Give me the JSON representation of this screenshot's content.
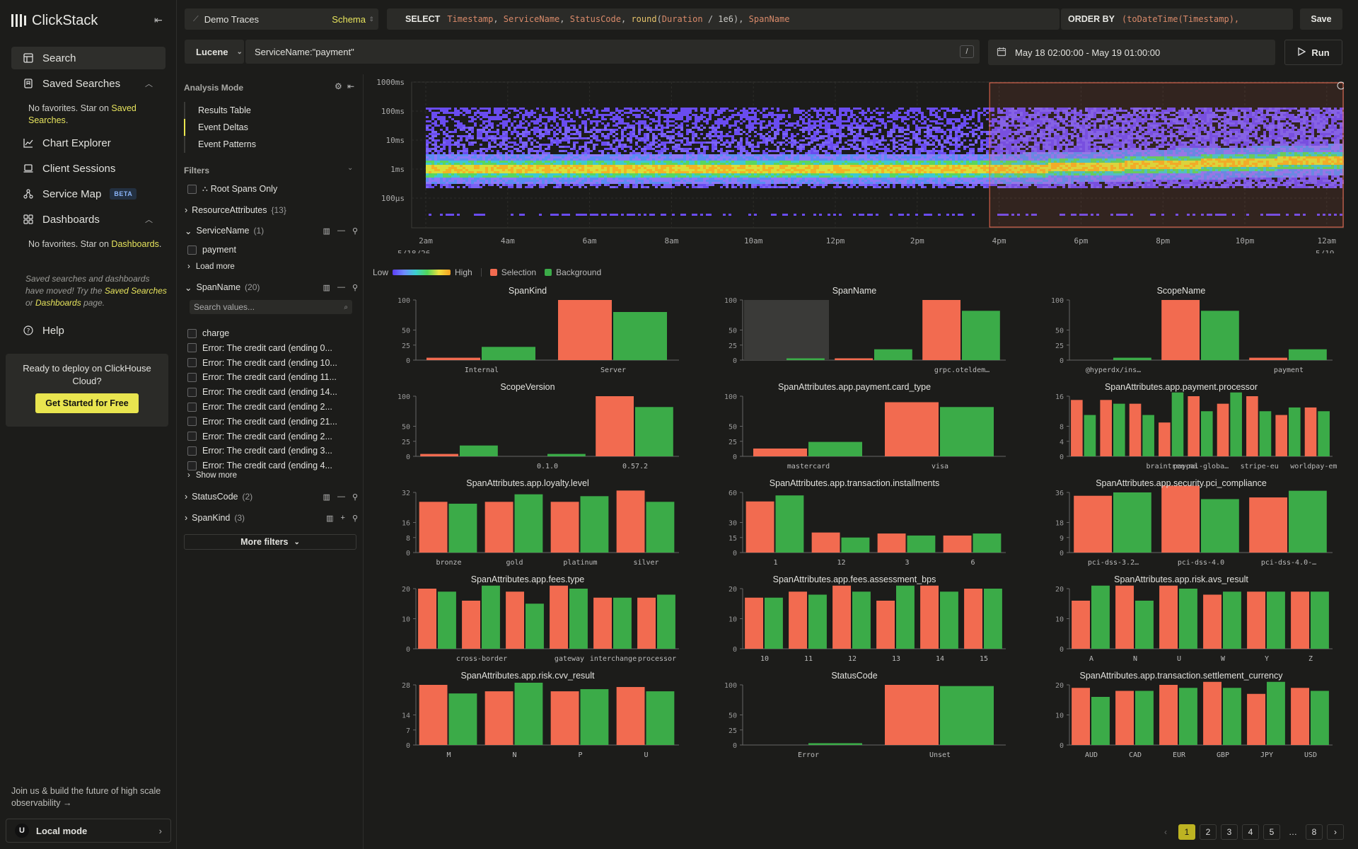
{
  "app": {
    "name": "ClickStack"
  },
  "nav": {
    "items": [
      {
        "label": "Search",
        "icon": "table-icon"
      },
      {
        "label": "Saved Searches",
        "icon": "bookmark-icon"
      },
      {
        "label": "Chart Explorer",
        "icon": "line-chart-icon"
      },
      {
        "label": "Client Sessions",
        "icon": "laptop-icon"
      },
      {
        "label": "Service Map",
        "icon": "graph-icon",
        "badge": "BETA"
      },
      {
        "label": "Dashboards",
        "icon": "grid-icon"
      },
      {
        "label": "Help",
        "icon": "help-icon"
      }
    ],
    "saved_note": {
      "pre": "No favorites. Star on ",
      "link": "Saved Searches",
      "post": "."
    },
    "dash_note": {
      "pre": "No favorites. Star on ",
      "link": "Dashboards",
      "post": "."
    },
    "moved": {
      "a": "Saved searches and dashboards have moved! Try the ",
      "link1": "Saved Searches",
      "b": " or ",
      "link2": "Dashboards",
      "c": " page."
    },
    "cloud": {
      "text": "Ready to deploy on ClickHouse Cloud?",
      "button": "Get Started for Free"
    },
    "join": "Join us & build the future of high scale observability →",
    "user": {
      "initial": "U",
      "mode": "Local mode"
    }
  },
  "topbar": {
    "source": "Demo Traces",
    "schema": "Schema",
    "select_kw": "SELECT",
    "select_value": "Timestamp, ServiceName, StatusCode, round(Duration / 1e6), SpanName",
    "orderby_kw": "ORDER BY",
    "orderby_value": "(toDateTime(Timestamp),",
    "save": "Save",
    "lang": "Lucene",
    "query": "ServiceName:\"payment\"",
    "slash": "/",
    "daterange": "May 18 02:00:00 - May 19 01:00:00",
    "run": "Run"
  },
  "filters": {
    "analysis_mode": "Analysis Mode",
    "modes": [
      "Results Table",
      "Event Deltas",
      "Event Patterns"
    ],
    "filters_label": "Filters",
    "root_spans": "Root Spans Only",
    "resource": {
      "label": "ResourceAttributes",
      "count": "{13}"
    },
    "service": {
      "label": "ServiceName",
      "count": "(1)",
      "values": [
        "payment"
      ],
      "load_more": "Load more"
    },
    "span": {
      "label": "SpanName",
      "count": "(20)",
      "search_placeholder": "Search values...",
      "values": [
        "charge",
        "Error: The credit card (ending 0...",
        "Error: The credit card (ending 10...",
        "Error: The credit card (ending 11...",
        "Error: The credit card (ending 14...",
        "Error: The credit card (ending 2...",
        "Error: The credit card (ending 21...",
        "Error: The credit card (ending 2...",
        "Error: The credit card (ending 3...",
        "Error: The credit card (ending 4..."
      ],
      "show_more": "Show more"
    },
    "status": {
      "label": "StatusCode",
      "count": "(2)"
    },
    "kind": {
      "label": "SpanKind",
      "count": "(3)"
    },
    "more": "More filters"
  },
  "heatmap": {
    "y_ticks": [
      "1000ms",
      "100ms",
      "10ms",
      "1ms",
      "100µs"
    ],
    "x_ticks": [
      "2am",
      "4am",
      "6am",
      "8am",
      "10am",
      "12pm",
      "2pm",
      "4pm",
      "6pm",
      "8pm",
      "10pm",
      "12am"
    ],
    "x_sub": {
      "first": "5/18/26",
      "last": "5/19"
    },
    "legend": {
      "low": "Low",
      "high": "High",
      "selection": "Selection",
      "background": "Background"
    },
    "colors": {
      "selection": "#f26b50",
      "background": "#3bab48"
    }
  },
  "chart_data": [
    {
      "type": "bar",
      "title": "SpanKind",
      "categories": [
        "Internal",
        "Server"
      ],
      "ylim": [
        0,
        100
      ],
      "yticks": [
        0,
        25,
        50,
        100
      ],
      "series": [
        {
          "name": "Selection",
          "values": [
            4,
            100
          ]
        },
        {
          "name": "Background",
          "values": [
            22,
            80
          ]
        }
      ]
    },
    {
      "type": "bar",
      "title": "SpanName",
      "categories": [
        "",
        "",
        "grpc.oteldem…"
      ],
      "ylim": [
        0,
        100
      ],
      "yticks": [
        0,
        25,
        50,
        100
      ],
      "hover": 0,
      "series": [
        {
          "name": "Selection",
          "values": [
            0,
            3,
            100
          ]
        },
        {
          "name": "Background",
          "values": [
            3,
            18,
            82
          ]
        }
      ]
    },
    {
      "type": "bar",
      "title": "ScopeName",
      "categories": [
        "@hyperdx/ins…",
        "",
        "payment"
      ],
      "ylim": [
        0,
        100
      ],
      "yticks": [
        0,
        25,
        50,
        100
      ],
      "series": [
        {
          "name": "Selection",
          "values": [
            0,
            100,
            4
          ]
        },
        {
          "name": "Background",
          "values": [
            4,
            82,
            18
          ]
        }
      ]
    },
    {
      "type": "bar",
      "title": "ScopeVersion",
      "categories": [
        "",
        "0.1.0",
        "0.57.2"
      ],
      "ylim": [
        0,
        100
      ],
      "yticks": [
        0,
        25,
        50,
        100
      ],
      "series": [
        {
          "name": "Selection",
          "values": [
            4,
            0,
            100
          ]
        },
        {
          "name": "Background",
          "values": [
            18,
            4,
            82
          ]
        }
      ]
    },
    {
      "type": "bar",
      "title": "SpanAttributes.app.payment.card_type",
      "categories": [
        "mastercard",
        "visa"
      ],
      "ylim": [
        0,
        100
      ],
      "yticks": [
        0,
        25,
        50,
        100
      ],
      "series": [
        {
          "name": "Selection",
          "values": [
            13,
            90
          ]
        },
        {
          "name": "Background",
          "values": [
            24,
            82
          ]
        }
      ]
    },
    {
      "type": "bar",
      "title": "SpanAttributes.app.payment.processor",
      "categories": [
        "",
        "braintree-na",
        "paypal-globa…",
        "stripe-eu",
        "worldpay-eme…"
      ],
      "ylim": [
        0,
        16
      ],
      "yticks": [
        0,
        4,
        8,
        16
      ],
      "series": [
        {
          "name": "Selection",
          "values": [
            15,
            15,
            14,
            9,
            16,
            14,
            16,
            11,
            13
          ]
        },
        {
          "name": "Background",
          "values": [
            11,
            14,
            11,
            17,
            12,
            17,
            12,
            13,
            12
          ]
        }
      ]
    },
    {
      "type": "bar",
      "title": "SpanAttributes.app.loyalty.level",
      "categories": [
        "bronze",
        "gold",
        "platinum",
        "silver"
      ],
      "ylim": [
        0,
        32
      ],
      "yticks": [
        0,
        8,
        16,
        32
      ],
      "series": [
        {
          "name": "Selection",
          "values": [
            27,
            27,
            27,
            33
          ]
        },
        {
          "name": "Background",
          "values": [
            26,
            31,
            30,
            27
          ]
        }
      ]
    },
    {
      "type": "bar",
      "title": "SpanAttributes.app.transaction.installments",
      "categories": [
        "1",
        "12",
        "3",
        "6"
      ],
      "ylim": [
        0,
        60
      ],
      "yticks": [
        0,
        15,
        30,
        60
      ],
      "series": [
        {
          "name": "Selection",
          "values": [
            51,
            20,
            19,
            17
          ]
        },
        {
          "name": "Background",
          "values": [
            57,
            15,
            17,
            19
          ]
        }
      ]
    },
    {
      "type": "bar",
      "title": "SpanAttributes.app.security.pci_compliance",
      "categories": [
        "pci-dss-3.2…",
        "pci-dss-4.0",
        "pci-dss-4.0-…"
      ],
      "ylim": [
        0,
        36
      ],
      "yticks": [
        0,
        9,
        18,
        36
      ],
      "series": [
        {
          "name": "Selection",
          "values": [
            34,
            40,
            33
          ]
        },
        {
          "name": "Background",
          "values": [
            36,
            32,
            37
          ]
        }
      ]
    },
    {
      "type": "bar",
      "title": "SpanAttributes.app.fees.type",
      "categories": [
        "",
        "cross-border",
        "gateway",
        "interchange",
        "processor"
      ],
      "ylim": [
        0,
        20
      ],
      "yticks": [
        0,
        10,
        20
      ],
      "series": [
        {
          "name": "Selection",
          "values": [
            20,
            16,
            19,
            21,
            17,
            17
          ]
        },
        {
          "name": "Background",
          "values": [
            19,
            21,
            15,
            20,
            17,
            18
          ]
        }
      ]
    },
    {
      "type": "bar",
      "title": "SpanAttributes.app.fees.assessment_bps",
      "categories": [
        "10",
        "11",
        "12",
        "13",
        "14",
        "15"
      ],
      "ylim": [
        0,
        20
      ],
      "yticks": [
        0,
        10,
        20
      ],
      "series": [
        {
          "name": "Selection",
          "values": [
            17,
            19,
            21,
            16,
            21,
            20
          ]
        },
        {
          "name": "Background",
          "values": [
            17,
            18,
            19,
            21,
            19,
            20
          ]
        }
      ]
    },
    {
      "type": "bar",
      "title": "SpanAttributes.app.risk.avs_result",
      "categories": [
        "A",
        "N",
        "U",
        "W",
        "Y",
        "Z"
      ],
      "ylim": [
        0,
        20
      ],
      "yticks": [
        0,
        10,
        20
      ],
      "series": [
        {
          "name": "Selection",
          "values": [
            16,
            21,
            21,
            18,
            19,
            19
          ]
        },
        {
          "name": "Background",
          "values": [
            21,
            16,
            20,
            19,
            19,
            19
          ]
        }
      ]
    },
    {
      "type": "bar",
      "title": "SpanAttributes.app.risk.cvv_result",
      "categories": [
        "M",
        "N",
        "P",
        "U"
      ],
      "ylim": [
        0,
        28
      ],
      "yticks": [
        0,
        7,
        14,
        28
      ],
      "series": [
        {
          "name": "Selection",
          "values": [
            28,
            25,
            25,
            27
          ]
        },
        {
          "name": "Background",
          "values": [
            24,
            29,
            26,
            25
          ]
        }
      ]
    },
    {
      "type": "bar",
      "title": "StatusCode",
      "categories": [
        "Error",
        "Unset"
      ],
      "ylim": [
        0,
        100
      ],
      "yticks": [
        0,
        25,
        50,
        100
      ],
      "series": [
        {
          "name": "Selection",
          "values": [
            0,
            100
          ]
        },
        {
          "name": "Background",
          "values": [
            3,
            98
          ]
        }
      ]
    },
    {
      "type": "bar",
      "title": "SpanAttributes.app.transaction.settlement_currency",
      "categories": [
        "AUD",
        "CAD",
        "EUR",
        "GBP",
        "JPY",
        "USD"
      ],
      "ylim": [
        0,
        20
      ],
      "yticks": [
        0,
        10,
        20
      ],
      "series": [
        {
          "name": "Selection",
          "values": [
            19,
            18,
            20,
            21,
            17,
            19
          ]
        },
        {
          "name": "Background",
          "values": [
            16,
            18,
            19,
            19,
            21,
            18
          ]
        }
      ]
    }
  ],
  "pager": {
    "pages": [
      "1",
      "2",
      "3",
      "4",
      "5",
      "…",
      "8"
    ],
    "current": "1"
  }
}
